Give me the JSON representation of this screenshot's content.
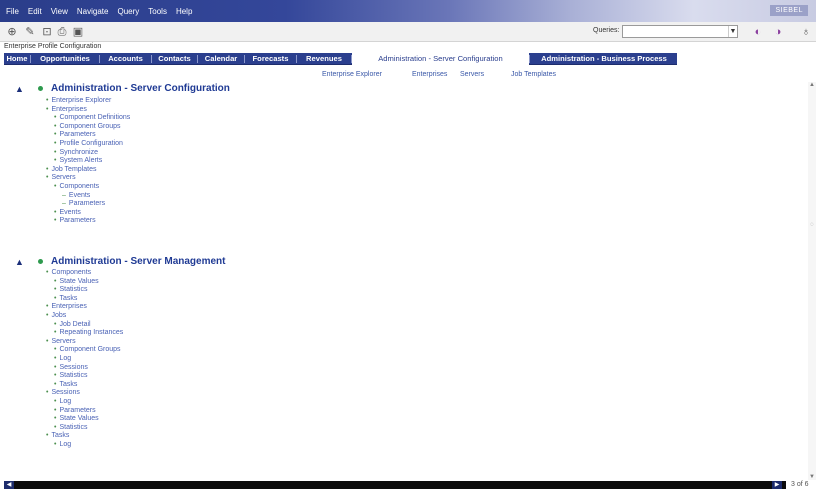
{
  "menu": [
    "File",
    "Edit",
    "View",
    "Navigate",
    "Query",
    "Tools",
    "Help"
  ],
  "brand": "SIEBEL",
  "toolbar": {
    "icons": [
      "site-map-icon",
      "edit-icon",
      "new-record-icon",
      "print-icon",
      "query-icon"
    ],
    "queries_label": "Queries:",
    "queries_value": "",
    "right_icons": [
      "back-icon",
      "forward-icon",
      "binoculars-icon"
    ]
  },
  "screen_title": "Enterprise Profile Configuration",
  "tabs": [
    {
      "label": "Home",
      "selected": false
    },
    {
      "label": "Opportunities",
      "selected": false
    },
    {
      "label": "Accounts",
      "selected": false
    },
    {
      "label": "Contacts",
      "selected": false
    },
    {
      "label": "Calendar",
      "selected": false
    },
    {
      "label": "Forecasts",
      "selected": false
    },
    {
      "label": "Revenues",
      "selected": false
    },
    {
      "label": "Administration - Server Configuration",
      "selected": true
    },
    {
      "label": "Administration - Business Process",
      "selected": false
    }
  ],
  "subtabs": [
    "Enterprise Explorer",
    "Enterprises",
    "Servers",
    "Job Templates"
  ],
  "sections": [
    {
      "title": "Administration - Server Configuration",
      "items": [
        {
          "label": "Enterprise Explorer",
          "level": 1
        },
        {
          "label": "Enterprises",
          "level": 1
        },
        {
          "label": "Component Definitions",
          "level": 2
        },
        {
          "label": "Component Groups",
          "level": 2
        },
        {
          "label": "Parameters",
          "level": 2
        },
        {
          "label": "Profile Configuration",
          "level": 2
        },
        {
          "label": "Synchronize",
          "level": 2
        },
        {
          "label": "System Alerts",
          "level": 2
        },
        {
          "label": "Job Templates",
          "level": 1
        },
        {
          "label": "Servers",
          "level": 1
        },
        {
          "label": "Components",
          "level": 2
        },
        {
          "label": "Events",
          "level": 3
        },
        {
          "label": "Parameters",
          "level": 3
        },
        {
          "label": "Events",
          "level": 2
        },
        {
          "label": "Parameters",
          "level": 2
        }
      ]
    },
    {
      "title": "Administration - Server Management",
      "items": [
        {
          "label": "Components",
          "level": 1
        },
        {
          "label": "State Values",
          "level": 2
        },
        {
          "label": "Statistics",
          "level": 2
        },
        {
          "label": "Tasks",
          "level": 2
        },
        {
          "label": "Enterprises",
          "level": 1
        },
        {
          "label": "Jobs",
          "level": 1
        },
        {
          "label": "Job Detail",
          "level": 2
        },
        {
          "label": "Repeating Instances",
          "level": 2
        },
        {
          "label": "Servers",
          "level": 1
        },
        {
          "label": "Component Groups",
          "level": 2
        },
        {
          "label": "Log",
          "level": 2
        },
        {
          "label": "Sessions",
          "level": 2
        },
        {
          "label": "Statistics",
          "level": 2
        },
        {
          "label": "Tasks",
          "level": 2
        },
        {
          "label": "Sessions",
          "level": 1
        },
        {
          "label": "Log",
          "level": 2
        },
        {
          "label": "Parameters",
          "level": 2
        },
        {
          "label": "State Values",
          "level": 2
        },
        {
          "label": "Statistics",
          "level": 2
        },
        {
          "label": "Tasks",
          "level": 1
        },
        {
          "label": "Log",
          "level": 2
        }
      ]
    }
  ],
  "page_count": "3 of 6",
  "colors": {
    "accent": "#2b3f8e",
    "link": "#4a62b5",
    "bullet": "#2e9a4e"
  }
}
